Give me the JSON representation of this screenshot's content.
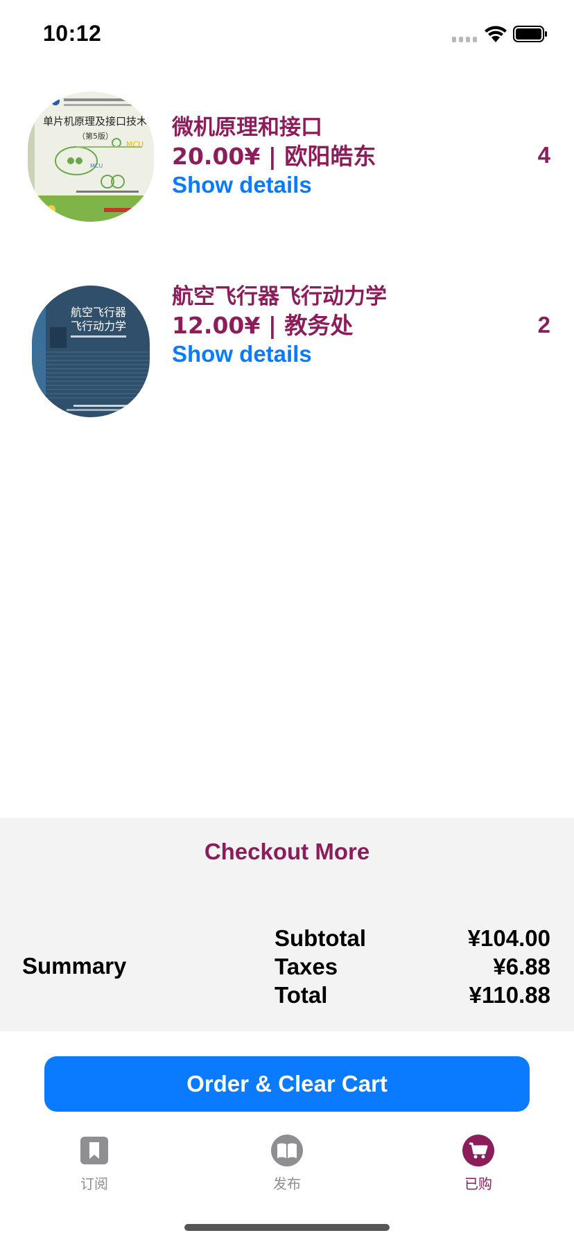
{
  "status_bar": {
    "time": "10:12"
  },
  "cart_items": [
    {
      "title": "微机原理和接口",
      "price_seller": "20.00¥ | 欧阳皓东",
      "details_link": "Show details",
      "quantity": "4",
      "cover_text": "单片机原理及接口技术",
      "cover_edition": "（第5版）"
    },
    {
      "title": "航空飞行器飞行动力学",
      "price_seller": "12.00¥ | 教务处",
      "details_link": "Show details",
      "quantity": "2",
      "cover_text": "航空飞行器飞行动力学"
    }
  ],
  "summary": {
    "checkout_more": "Checkout More",
    "label": "Summary",
    "rows": [
      {
        "label": "Subtotal",
        "value": "¥104.00"
      },
      {
        "label": "Taxes",
        "value": "¥6.88"
      },
      {
        "label": "Total",
        "value": "¥110.88"
      }
    ]
  },
  "order_button": "Order & Clear Cart",
  "tab_bar": {
    "tabs": [
      {
        "label": "订阅",
        "icon": "bookmark-icon",
        "active": false
      },
      {
        "label": "发布",
        "icon": "book-icon",
        "active": false
      },
      {
        "label": "已购",
        "icon": "cart-icon",
        "active": true
      }
    ]
  },
  "colors": {
    "accent": "#8b1d5a",
    "link": "#0a7bff",
    "panel_bg": "#f3f3f3",
    "inactive_tab": "#8e8e93"
  }
}
